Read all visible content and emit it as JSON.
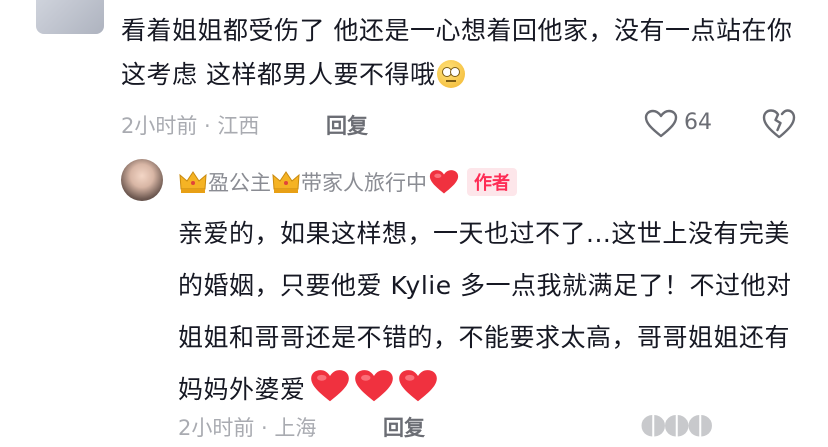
{
  "comment1": {
    "text": "看着姐姐都受伤了 他还是一心想着回他家，没有一点站在你这考虑  这样都男人要不得哦",
    "emoji": "eye-roll-emoji",
    "time_location": "2小时前 · 江西",
    "reply_label": "回复",
    "like_count": "64"
  },
  "reply1": {
    "name_prefix_icon": "crown-emoji",
    "name_part1": "盈公主",
    "name_part2": "带家人旅行中",
    "name_suffix_icon": "red-heart-emoji",
    "author_badge": "作者",
    "text": "亲爱的，如果这样想，一天也过不了...这世上没有完美的婚姻，只要他爱 Kylie 多一点我就满足了！不过他对姐姐和哥哥还是不错的，不能要求太高，哥哥姐姐还有妈妈外婆爱",
    "trailing_emoji_count": 3,
    "time_location": "2小时前 · 上海",
    "reply_label": "回复"
  },
  "colors": {
    "text": "#161823",
    "meta": "#a9abb1",
    "author_badge_bg": "#fde6ea",
    "author_badge_text": "#fe2c55",
    "heart": "#fe2c55"
  }
}
